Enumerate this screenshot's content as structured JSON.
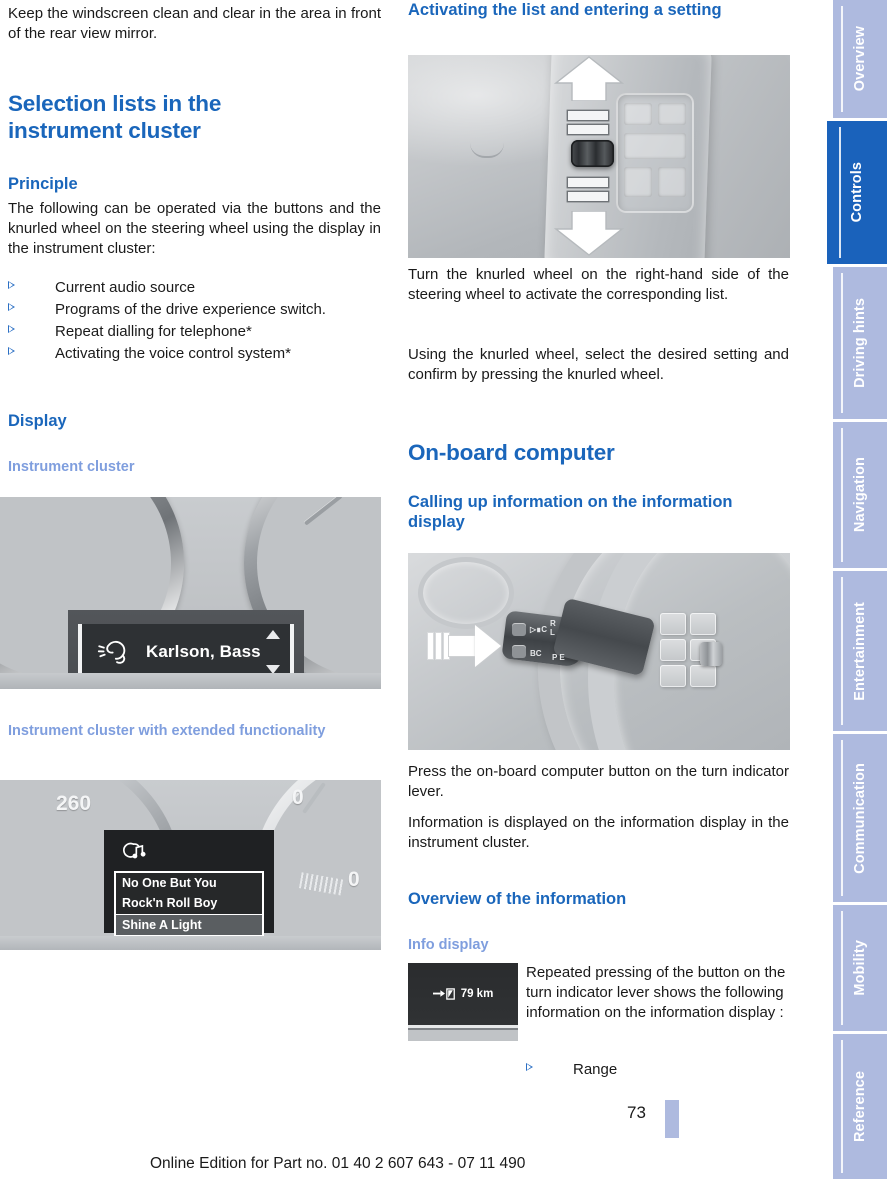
{
  "left_column": {
    "intro_paragraph": "Keep the windscreen clean and clear in the area in front of the rear view mirror.",
    "section_title": "Selection lists in the instrument cluster",
    "principle_heading": "Principle",
    "principle_paragraph": "The following can be operated via the buttons and the knurled wheel on the steering wheel using the display in the instrument cluster:",
    "principle_bullets": [
      "Current audio source",
      "Programs of the drive experience switch.",
      "Repeat dialling for telephone*",
      "Activating the voice control system*"
    ],
    "display_heading": "Display",
    "instrument_cluster_heading": "Instrument cluster",
    "cluster_figure": {
      "icon": "telephone-handset-icon",
      "text": "Karlson, Bass",
      "scroll_up_icon": "scroll-up-arrow-icon",
      "scroll_down_icon": "scroll-down-arrow-icon"
    },
    "extended_heading": "Instrument cluster with extended functionality",
    "extended_figure": {
      "icon": "audio-source-music-icon",
      "left_gauge_label": "260",
      "right_gauge_label_top": "0",
      "right_gauge_label_bottom": "0",
      "tracks": [
        {
          "title": "No One But You",
          "selected": false
        },
        {
          "title": "Rock'n Roll Boy",
          "selected": false
        },
        {
          "title": "Shine A Light",
          "selected": true
        }
      ]
    }
  },
  "right_column": {
    "activating_heading": "Activating the list and entering a setting",
    "knurled_figure": {
      "arrow_up_icon": "arrow-up-icon",
      "arrow_down_icon": "arrow-down-icon",
      "knob_icon": "knurled-wheel-icon"
    },
    "paragraph_1": "Turn the knurled wheel on the right-hand side of the steering wheel to activate the corresponding list.",
    "paragraph_2": "Using the knurled wheel, select the desired setting and confirm by pressing the knurled wheel.",
    "onboard_title": "On-board computer",
    "calling_heading": "Calling up information on the information display",
    "lever_figure": {
      "arrow_icon": "arrow-right-icon"
    },
    "paragraph_3": "Press the on-board computer button on the turn indicator lever.",
    "paragraph_4": "Information is displayed on the information display in the instrument cluster.",
    "overview_heading": "Overview of the information",
    "info_display_heading": "Info display",
    "info_figure": {
      "range_icon": "fuel-pump-arrow-icon",
      "range_value": "79 km"
    },
    "info_paragraph": "Repeated pressing of the button on the turn indicator lever shows the following information on the information display :",
    "info_bullets": [
      "Range"
    ]
  },
  "sidebar": {
    "tabs": [
      {
        "label": "Overview",
        "active": false
      },
      {
        "label": "Controls",
        "active": true
      },
      {
        "label": "Driving hints",
        "active": false
      },
      {
        "label": "Navigation",
        "active": false
      },
      {
        "label": "Entertainment",
        "active": false
      },
      {
        "label": "Communication",
        "active": false
      },
      {
        "label": "Mobility",
        "active": false
      },
      {
        "label": "Reference",
        "active": false
      }
    ]
  },
  "footer": {
    "page_number": "73",
    "edition_line": "Online Edition for Part no. 01 40 2 607 643 - 07 11 490"
  },
  "colors": {
    "accent_blue": "#1a66bb",
    "active_tab_blue": "#1a62bb",
    "light_blue": "#aebadf",
    "subheading_blue": "#7f9ede"
  }
}
